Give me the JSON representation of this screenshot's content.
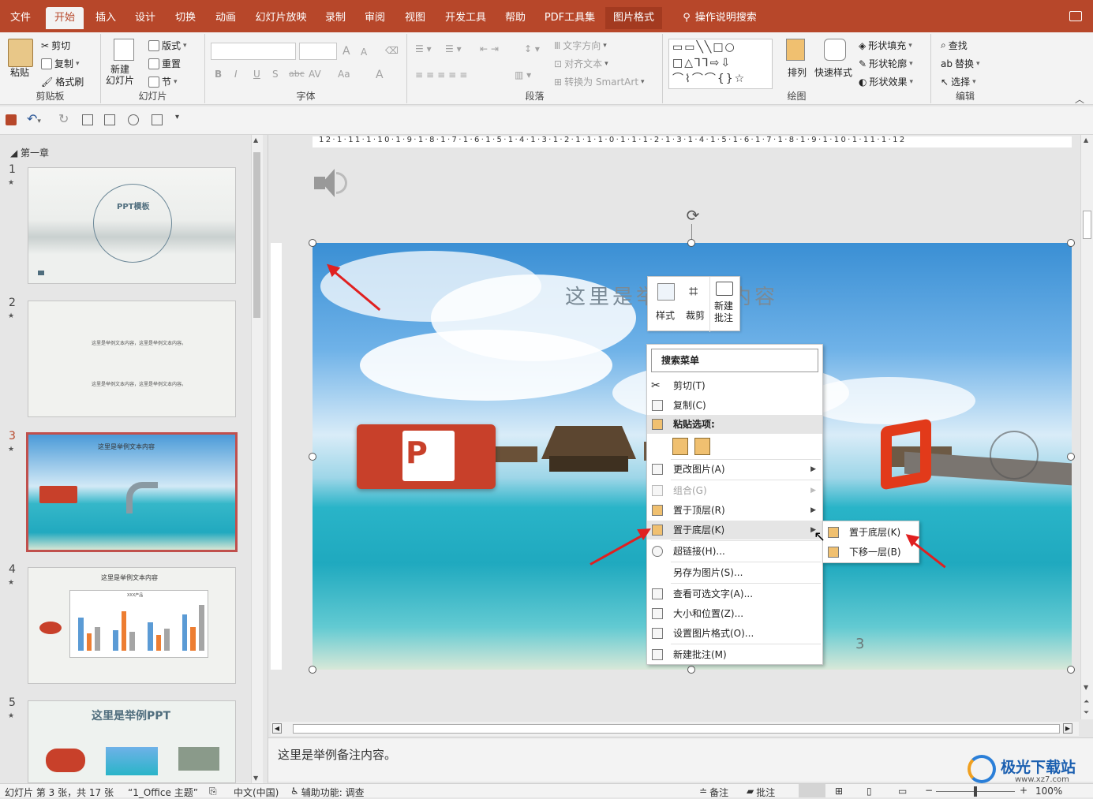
{
  "tabs": [
    "文件",
    "开始",
    "插入",
    "设计",
    "切换",
    "动画",
    "幻灯片放映",
    "录制",
    "审阅",
    "视图",
    "开发工具",
    "帮助",
    "PDF工具集",
    "图片格式"
  ],
  "active_tab": "开始",
  "tell_me": "操作说明搜索",
  "ribbon": {
    "clipboard": {
      "label": "剪贴板",
      "paste": "粘贴",
      "cut": "剪切",
      "copy": "复制",
      "format_painter": "格式刷"
    },
    "slides": {
      "label": "幻灯片",
      "new_slide": "新建\n幻灯片",
      "layout": "版式",
      "reset": "重置",
      "section": "节"
    },
    "font": {
      "label": "字体",
      "bold": "B",
      "italic": "I",
      "underline": "U",
      "shadow": "S",
      "strike": "abc",
      "spacing": "AV",
      "case": "Aa",
      "color": "A"
    },
    "paragraph": {
      "label": "段落",
      "text_direction": "文字方向",
      "align_text": "对齐文本",
      "convert_smartart": "转换为 SmartArt"
    },
    "drawing": {
      "label": "绘图",
      "arrange": "排列",
      "quick_styles": "快速样式",
      "shape_fill": "形状填充",
      "shape_outline": "形状轮廓",
      "shape_effects": "形状效果"
    },
    "editing": {
      "label": "编辑",
      "find": "查找",
      "replace": "替换",
      "select": "选择"
    }
  },
  "sidebar": {
    "section": "第一章",
    "slides": [
      {
        "num": "1",
        "title": "PPT模板"
      },
      {
        "num": "2",
        "line1": "这里是举例文本内容，这里是举例文本内容。",
        "line2": "这里是举例文本内容，这里是举例文本内容。"
      },
      {
        "num": "3",
        "title": "这里是举例文本内容"
      },
      {
        "num": "4",
        "title": "这里是举例文本内容",
        "chart_title": "XXX产品"
      },
      {
        "num": "5",
        "title": "这里是举例PPT"
      }
    ]
  },
  "ruler_h": "12·1·11·1·10·1·9·1·8·1·7·1·6·1·5·1·4·1·3·1·2·1·1·1·0·1·1·1·2·1·3·1·4·1·5·1·6·1·7·1·8·1·9·1·10·1·11·1·12",
  "slide": {
    "title": "这里是举例文本内容",
    "page_num": "3"
  },
  "mini_toolbar": {
    "style": "样式",
    "crop": "裁剪",
    "new_comment": "新建\n批注"
  },
  "context_menu": {
    "search_placeholder": "搜索菜单",
    "items": [
      {
        "label": "剪切(T)"
      },
      {
        "label": "复制(C)"
      },
      {
        "label": "粘贴选项:"
      },
      {
        "label": "更改图片(A)"
      },
      {
        "label": "组合(G)"
      },
      {
        "label": "置于顶层(R)"
      },
      {
        "label": "置于底层(K)"
      },
      {
        "label": "超链接(H)..."
      },
      {
        "label": "另存为图片(S)..."
      },
      {
        "label": "查看可选文字(A)..."
      },
      {
        "label": "大小和位置(Z)..."
      },
      {
        "label": "设置图片格式(O)..."
      },
      {
        "label": "新建批注(M)"
      }
    ]
  },
  "submenu": [
    "置于底层(K)",
    "下移一层(B)"
  ],
  "notes": "这里是举例备注内容。",
  "status": {
    "slide_info": "幻灯片 第 3 张，共 17 张",
    "theme": "“1_Office 主题”",
    "language": "中文(中国)",
    "accessibility": "辅助功能: 调查",
    "notes_btn": "备注",
    "comments_btn": "批注",
    "zoom": "100%"
  },
  "watermark": {
    "name": "极光下载站",
    "url": "www.xz7.com"
  },
  "colors": {
    "accent": "#b7472a",
    "arrow": "#e02020"
  }
}
